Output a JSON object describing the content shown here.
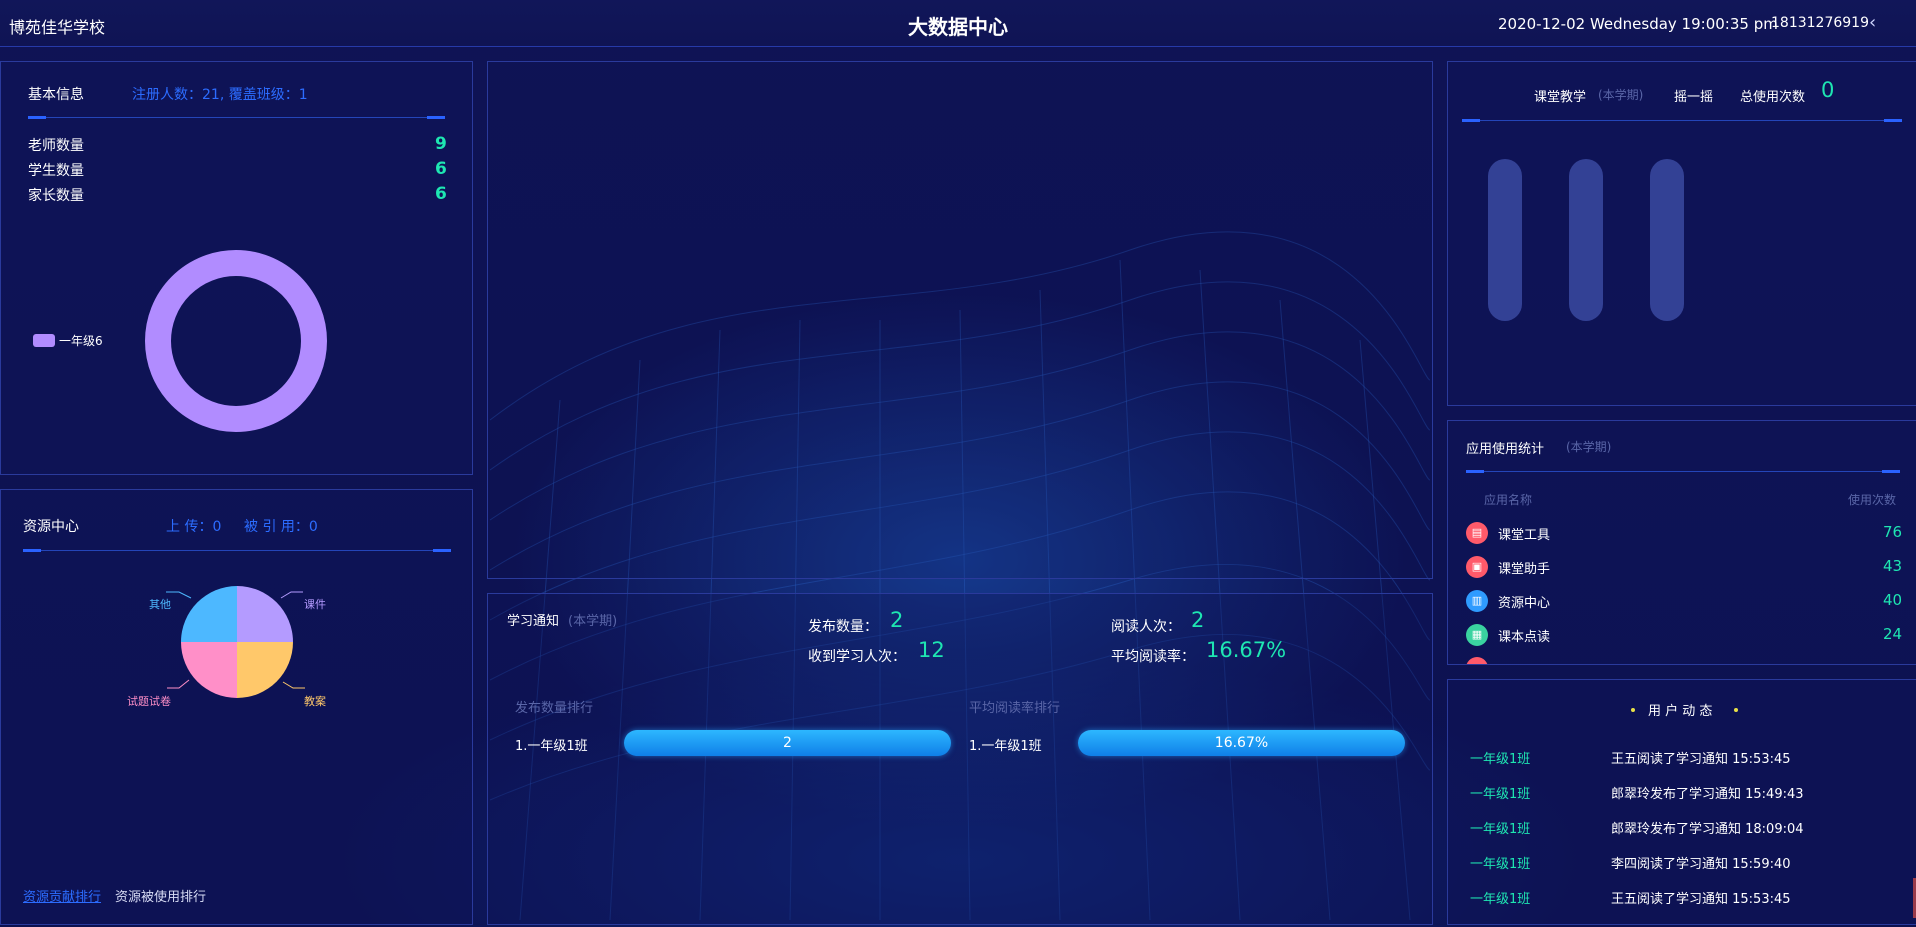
{
  "header": {
    "school": "博苑佳华学校",
    "title": "大数据中心",
    "datetime": "2020-12-02 Wednesday 19:00:35 pm",
    "phone": "18131276919",
    "back_icon": "‹"
  },
  "basic_info": {
    "title": "基本信息",
    "summary": "注册人数：21, 覆盖班级：1",
    "rows": [
      {
        "label": "老师数量",
        "value": "9"
      },
      {
        "label": "学生数量",
        "value": "6"
      },
      {
        "label": "家长数量",
        "value": "6"
      }
    ],
    "legend": "一年级6",
    "ring_color": "#b18cff"
  },
  "resource_center": {
    "title": "资源中心",
    "upload": "上 传：0",
    "cited": "被 引 用：0",
    "pie_labels": [
      "其他",
      "课件",
      "试题试卷",
      "教案"
    ],
    "pie_colors": [
      "#4db8ff",
      "#b49bff",
      "#ff8fc8",
      "#ffc86a"
    ],
    "link_contrib": "资源贡献排行",
    "link_used": "资源被使用排行"
  },
  "study_notice": {
    "title": "学习通知",
    "subtitle": "(本学期)",
    "publish_label": "发布数量：",
    "publish_value": "2",
    "receive_label": "收到学习人次：",
    "receive_value": "12",
    "read_label": "阅读人次：",
    "read_value": "2",
    "rate_label": "平均阅读率：",
    "rate_value": "16.67%",
    "rank_publish_title": "发布数量排行",
    "rank_rate_title": "平均阅读率排行",
    "rank_publish": {
      "name": "1.一年级1班",
      "value": "2"
    },
    "rank_rate": {
      "name": "1.一年级1班",
      "value": "16.67%"
    }
  },
  "classroom": {
    "title": "课堂教学",
    "subtitle": "(本学期)",
    "shake": "摇一摇",
    "total_label": "总使用次数",
    "total_value": "0"
  },
  "app_stats": {
    "title": "应用使用统计",
    "subtitle": "(本学期)",
    "col_name": "应用名称",
    "col_count": "使用次数",
    "items": [
      {
        "name": "课堂工具",
        "count": "76",
        "icon": "toolbox-icon",
        "color": "#ff5a6a"
      },
      {
        "name": "课堂助手",
        "count": "43",
        "icon": "assistant-icon",
        "color": "#ff5a6a"
      },
      {
        "name": "资源中心",
        "count": "40",
        "icon": "folder-icon",
        "color": "#2f9bff"
      },
      {
        "name": "课本点读",
        "count": "24",
        "icon": "book-read-icon",
        "color": "#3ad3a0"
      }
    ]
  },
  "user_activity": {
    "title": "用 户 动 态",
    "items": [
      {
        "class": "一年级1班",
        "text": "王五阅读了学习通知 15:53:45"
      },
      {
        "class": "一年级1班",
        "text": "郎翠玲发布了学习通知 15:49:43"
      },
      {
        "class": "一年级1班",
        "text": "郎翠玲发布了学习通知 18:09:04"
      },
      {
        "class": "一年级1班",
        "text": "李四阅读了学习通知 15:59:40"
      },
      {
        "class": "一年级1班",
        "text": "王五阅读了学习通知 15:53:45"
      }
    ]
  }
}
